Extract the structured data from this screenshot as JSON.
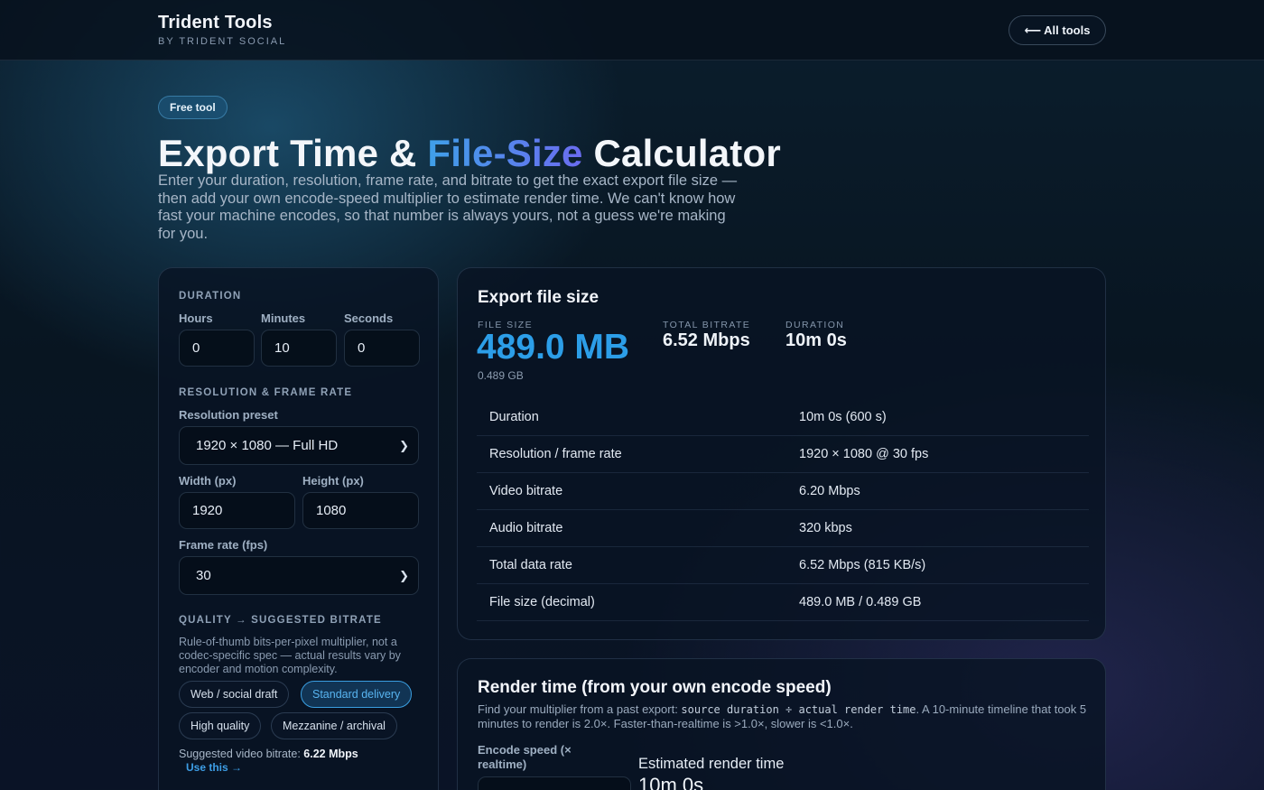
{
  "header": {
    "brand_title": "Trident Tools",
    "brand_sub": "BY TRIDENT SOCIAL",
    "all_tools_arrow": "⟵",
    "all_tools_label": "All tools"
  },
  "hero": {
    "badge": "Free tool",
    "title_part1": "Export Time & ",
    "title_accent": "File-Size",
    "title_part2": " Calculator",
    "lead": "Enter your duration, resolution, frame rate, and bitrate to get the exact export file size — then add your own encode-speed multiplier to estimate render time. We can't know how fast your machine encodes, so that number is always yours, not a guess we're making for you."
  },
  "inputs": {
    "duration_label": "DURATION",
    "hours_label": "Hours",
    "hours_value": "0",
    "minutes_label": "Minutes",
    "minutes_value": "10",
    "seconds_label": "Seconds",
    "seconds_value": "0",
    "res_section_label": "RESOLUTION & FRAME RATE",
    "res_preset_label": "Resolution preset",
    "res_preset_value": "1920 × 1080 — Full HD",
    "width_label": "Width (px)",
    "width_value": "1920",
    "height_label": "Height (px)",
    "height_value": "1080",
    "fps_label": "Frame rate (fps)",
    "fps_value": "30",
    "quality_label": "QUALITY → SUGGESTED BITRATE",
    "quality_help": "Rule-of-thumb bits-per-pixel multiplier, not a codec-specific spec — actual results vary by encoder and motion complexity.",
    "chips": [
      "Web / social draft",
      "Standard delivery",
      "High quality",
      "Mezzanine / archival"
    ],
    "active_chip": "Standard delivery",
    "suggested_prefix": "Suggested video bitrate: ",
    "suggested_value": "6.22 Mbps",
    "use_this": "Use this →"
  },
  "export": {
    "title": "Export file size",
    "file_size_label": "FILE SIZE",
    "file_size_value": "489.0 MB",
    "file_size_gb": "0.489 GB",
    "total_bitrate_label": "TOTAL BITRATE",
    "total_bitrate_value": "6.52 Mbps",
    "duration_label": "DURATION",
    "duration_value": "10m 0s",
    "rows": [
      {
        "k": "Duration",
        "v": "10m 0s (600 s)"
      },
      {
        "k": "Resolution / frame rate",
        "v": "1920 × 1080 @ 30 fps"
      },
      {
        "k": "Video bitrate",
        "v": "6.20 Mbps"
      },
      {
        "k": "Audio bitrate",
        "v": "320 kbps"
      },
      {
        "k": "Total data rate",
        "v": "6.52 Mbps (815 KB/s)"
      },
      {
        "k": "File size (decimal)",
        "v": "489.0 MB / 0.489 GB"
      }
    ]
  },
  "render": {
    "title": "Render time (from your own encode speed)",
    "desc_prefix": "Find your multiplier from a past export: ",
    "desc_code": "source duration ÷ actual render time",
    "desc_suffix": ". A 10-minute timeline that took 5 minutes to render is 2.0×. Faster-than-realtime is >1.0×, slower is <1.0×.",
    "encode_label": "Encode speed (× realtime)",
    "estimated_label": "Estimated render time",
    "estimated_value": "10m 0s"
  },
  "colors": {
    "accent": "#2c9ee8",
    "accent_gradient_end": "#6b6cf0",
    "background": "#081521"
  }
}
